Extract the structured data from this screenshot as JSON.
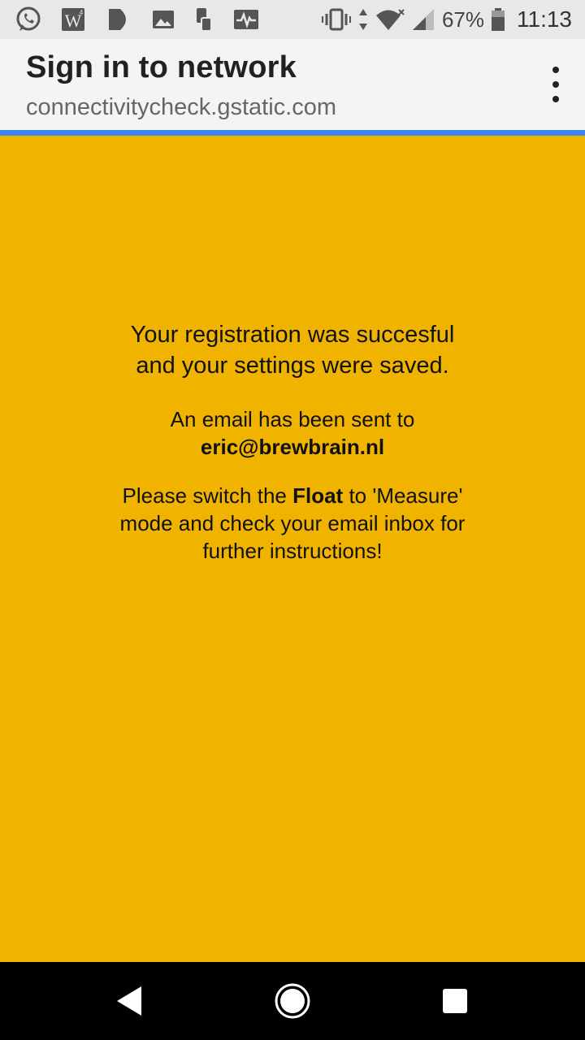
{
  "status_bar": {
    "battery_percent": "67%",
    "time": "11:13",
    "left_icons": [
      "whatsapp-icon",
      "word-icon",
      "play-icon",
      "gallery-icon",
      "phone-device-icon",
      "activity-icon"
    ],
    "right_icons": [
      "vibrate-icon",
      "data-arrows-icon",
      "wifi-icon",
      "signal-icon",
      "battery-icon"
    ]
  },
  "app_bar": {
    "title": "Sign in to network",
    "subtitle": "connectivitycheck.gstatic.com",
    "menu_icon": "more-vert-icon"
  },
  "content": {
    "registration_line1": "Your registration was succesful",
    "registration_line2": "and your settings were saved.",
    "email_intro": "An email has been sent to",
    "email_address": "eric@brewbrain.nl",
    "instr_pre": "Please switch the ",
    "instr_bold": "Float",
    "instr_post": " to 'Measure'",
    "instr_line2": "mode and check your email inbox for",
    "instr_line3": "further instructions!"
  },
  "colors": {
    "background": "#f0b400",
    "progress": "#3f86f4",
    "app_bar": "#f4f4f4",
    "status_bar": "#e8e8e8"
  },
  "nav_bar": {
    "buttons": [
      "back-icon",
      "home-icon",
      "recents-icon"
    ]
  }
}
